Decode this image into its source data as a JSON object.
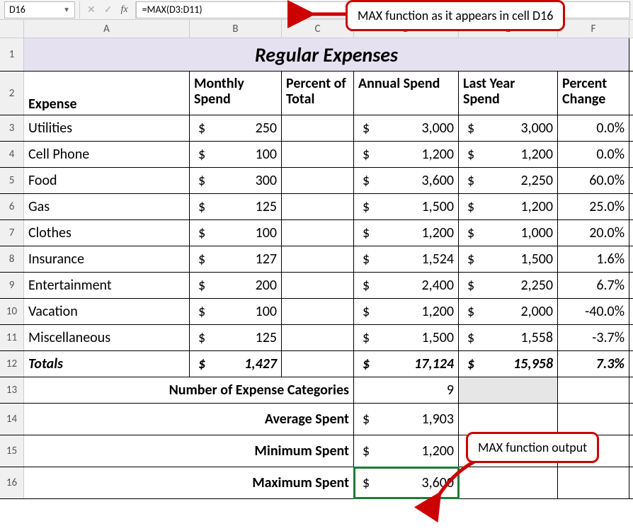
{
  "nameBox": "D16",
  "formula": "=MAX(D3:D11)",
  "callout1": "MAX function as it appears in cell D16",
  "callout2": "MAX function output",
  "cols": [
    "A",
    "B",
    "C",
    "D",
    "E",
    "F"
  ],
  "title": "Regular Expenses",
  "headers": {
    "A": "Expense",
    "B": "Monthly Spend",
    "C": "Percent of Total",
    "D": "Annual Spend",
    "E": "Last Year Spend",
    "F": "Percent Change"
  },
  "rows": [
    {
      "n": 3,
      "expense": "Utilities",
      "monthly": "250",
      "annual": "3,000",
      "last": "3,000",
      "pct": "0.0%"
    },
    {
      "n": 4,
      "expense": "Cell Phone",
      "monthly": "100",
      "annual": "1,200",
      "last": "1,200",
      "pct": "0.0%"
    },
    {
      "n": 5,
      "expense": "Food",
      "monthly": "300",
      "annual": "3,600",
      "last": "2,250",
      "pct": "60.0%"
    },
    {
      "n": 6,
      "expense": "Gas",
      "monthly": "125",
      "annual": "1,500",
      "last": "1,200",
      "pct": "25.0%"
    },
    {
      "n": 7,
      "expense": "Clothes",
      "monthly": "100",
      "annual": "1,200",
      "last": "1,000",
      "pct": "20.0%"
    },
    {
      "n": 8,
      "expense": "Insurance",
      "monthly": "127",
      "annual": "1,524",
      "last": "1,500",
      "pct": "1.6%"
    },
    {
      "n": 9,
      "expense": "Entertainment",
      "monthly": "200",
      "annual": "2,400",
      "last": "2,250",
      "pct": "6.7%"
    },
    {
      "n": 10,
      "expense": "Vacation",
      "monthly": "100",
      "annual": "1,200",
      "last": "2,000",
      "pct": "-40.0%"
    },
    {
      "n": 11,
      "expense": "Miscellaneous",
      "monthly": "125",
      "annual": "1,500",
      "last": "1,558",
      "pct": "-3.7%"
    }
  ],
  "totals": {
    "n": 12,
    "label": "Totals",
    "monthly": "1,427",
    "annual": "17,124",
    "last": "15,958",
    "pct": "7.3%"
  },
  "summary": [
    {
      "n": 13,
      "label": "Number of Expense Categories",
      "value": "9",
      "money": false
    },
    {
      "n": 14,
      "label": "Average Spent",
      "value": "1,903",
      "money": true
    },
    {
      "n": 15,
      "label": "Minimum Spent",
      "value": "1,200",
      "money": true
    },
    {
      "n": 16,
      "label": "Maximum Spent",
      "value": "3,600",
      "money": true
    }
  ],
  "dollar": "$"
}
